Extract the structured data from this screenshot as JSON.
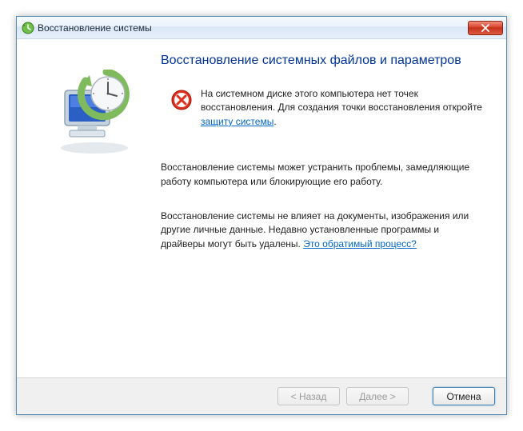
{
  "window": {
    "title": "Восстановление системы"
  },
  "content": {
    "heading": "Восстановление системных файлов и параметров",
    "error_text_1": "На системном диске этого компьютера нет точек восстановления. Для создания точки восстановления откройте ",
    "error_link": "защиту системы",
    "error_text_2": ".",
    "para1": "Восстановление системы может устранить проблемы, замедляющие работу компьютера или блокирующие его работу.",
    "para2_1": "Восстановление системы не влияет на документы, изображения или другие личные данные. Недавно установленные программы и драйверы могут быть удалены. ",
    "para2_link": "Это обратимый процесс?"
  },
  "buttons": {
    "back": "< Назад",
    "next": "Далее >",
    "cancel": "Отмена"
  }
}
